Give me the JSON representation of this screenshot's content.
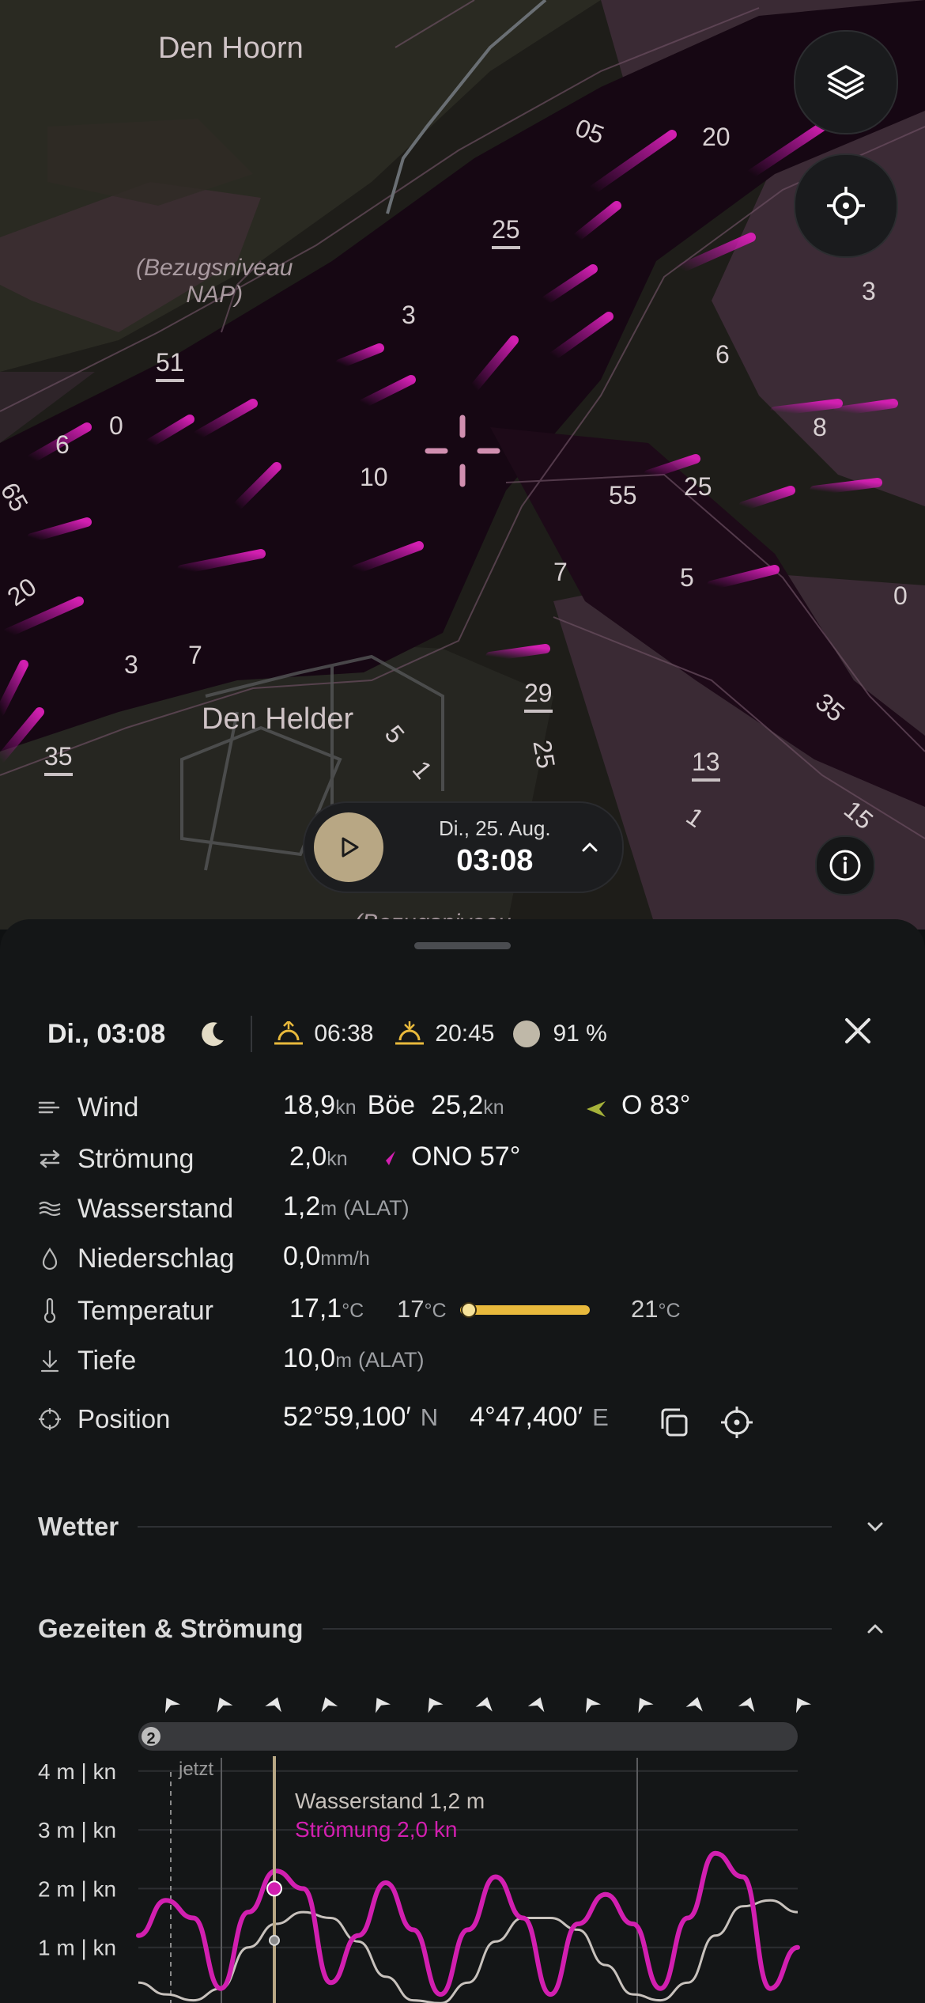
{
  "map": {
    "places": [
      {
        "key": "den_hoorn",
        "text": "Den Hoorn"
      },
      {
        "key": "den_helder",
        "text": "Den Helder"
      }
    ],
    "reference_label_line1": "(Bezugsniveau",
    "reference_label_line2": "NAP)",
    "reference_label_bottom": "(Bezugsniveau",
    "depths": [
      "05",
      "20",
      "25",
      "3",
      "3",
      "51",
      "6",
      "8",
      "0",
      "6",
      "65",
      "10",
      "55",
      "25",
      "7",
      "5",
      "0",
      "20",
      "3",
      "7",
      "29",
      "35",
      "35",
      "25",
      "13",
      "15",
      "1",
      "5",
      "1"
    ]
  },
  "controls": {
    "layers_icon": "layers-icon",
    "locate_icon": "crosshair-icon",
    "info_icon": "info-icon"
  },
  "time_pill": {
    "date": "Di., 25. Aug.",
    "time": "03:08"
  },
  "summary": {
    "datetime": "Di., 03:08",
    "sunrise": "06:38",
    "sunset": "20:45",
    "moon_illumination": "91 %"
  },
  "details": {
    "wind": {
      "label": "Wind",
      "speed": "18,9",
      "speed_unit": "kn",
      "gust_label": "Böe",
      "gust": "25,2",
      "gust_unit": "kn",
      "direction": "O 83°"
    },
    "current": {
      "label": "Strömung",
      "speed": "2,0",
      "speed_unit": "kn",
      "direction": "ONO 57°"
    },
    "water_level": {
      "label": "Wasserstand",
      "value": "1,2",
      "unit": "m",
      "datum": "(ALAT)"
    },
    "precipitation": {
      "label": "Niederschlag",
      "value": "0,0",
      "unit": "mm/h"
    },
    "temperature": {
      "label": "Temperatur",
      "value": "17,1",
      "unit": "°C",
      "min": "17",
      "min_unit": "°C",
      "max": "21",
      "max_unit": "°C",
      "position_fraction": 0.04
    },
    "depth": {
      "label": "Tiefe",
      "value": "10,0",
      "unit": "m",
      "datum": "(ALAT)"
    },
    "position": {
      "label": "Position",
      "lat": "52°59,100′",
      "lat_hem": "N",
      "lon": "4°47,400′",
      "lon_hem": "E"
    }
  },
  "sections": {
    "weather": "Wetter",
    "tides": "Gezeiten & Strömung"
  },
  "chart_data": {
    "type": "line",
    "now_label": "jetzt",
    "day_badge": "2",
    "y_ticks": [
      "1 m | kn",
      "2 m | kn",
      "3 m | kn",
      "4 m | kn"
    ],
    "ylim": [
      0,
      4.5
    ],
    "tooltip_water": "Wasserstand 1,2 m",
    "tooltip_current": "Strömung 2,0 kn",
    "series": [
      {
        "name": "Wasserstand",
        "color": "#c8c2bd",
        "values": [
          0.4,
          0.2,
          0.1,
          0.3,
          1.0,
          1.4,
          1.6,
          1.5,
          1.1,
          0.5,
          0.1,
          0.05,
          0.4,
          1.1,
          1.5,
          1.5,
          1.3,
          0.7,
          0.2,
          0.1,
          0.4,
          1.2,
          1.7,
          1.8,
          1.6
        ]
      },
      {
        "name": "Strömung",
        "color": "#d21fb0",
        "values": [
          1.2,
          1.8,
          1.5,
          0.3,
          1.6,
          2.3,
          2.0,
          0.4,
          1.2,
          2.1,
          1.3,
          0.2,
          1.3,
          2.2,
          1.5,
          0.2,
          1.4,
          1.9,
          1.4,
          0.3,
          1.5,
          2.6,
          2.2,
          0.3,
          1.0
        ]
      }
    ],
    "current_value_x": 4,
    "arrow_rotations_deg": [
      -30,
      -25,
      20,
      -20,
      -30,
      -30,
      15,
      20,
      -30,
      -30,
      15,
      20,
      -30
    ]
  },
  "colors": {
    "magenta": "#d21fb0",
    "gold": "#b8a784",
    "temp_bar": "#e8b93c",
    "wind_arrow": "#a6b23a"
  }
}
